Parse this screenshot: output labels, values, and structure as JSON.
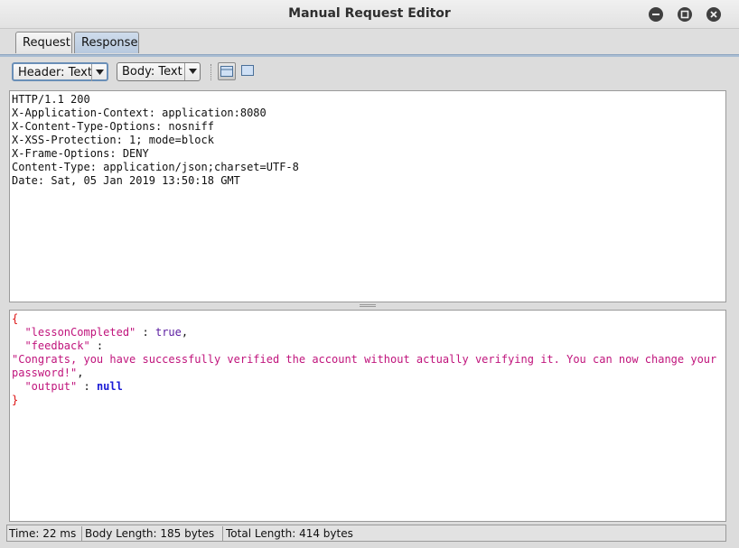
{
  "window": {
    "title": "Manual Request Editor"
  },
  "tabs": [
    {
      "label": "Request"
    },
    {
      "label": "Response"
    }
  ],
  "toolbar": {
    "header_select": "Header: Text",
    "body_select": "Body: Text"
  },
  "response_header": {
    "lines": [
      "HTTP/1.1 200",
      "X-Application-Context: application:8080",
      "X-Content-Type-Options: nosniff",
      "X-XSS-Protection: 1; mode=block",
      "X-Frame-Options: DENY",
      "Content-Type: application/json;charset=UTF-8",
      "Date: Sat, 05 Jan 2019 13:50:18 GMT"
    ]
  },
  "response_body": {
    "open_brace": "{",
    "close_brace": "}",
    "key1": "\"lessonCompleted\"",
    "val1": "true",
    "key2": "\"feedback\"",
    "val2": "\"Congrats, you have successfully verified the account without actually verifying it. You can now change your password!\"",
    "key3": "\"output\"",
    "val3": "null"
  },
  "status": {
    "time": "Time: 22 ms",
    "body_length": "Body Length: 185 bytes",
    "total_length": "Total Length: 414 bytes"
  },
  "colors": {
    "brace": "#dd1111",
    "json_key": "#c0147c",
    "json_bool": "#5a1ba0",
    "json_null": "#1b1bd6",
    "tab_active": "#b8c9de"
  },
  "icons": {
    "minimize": "minimize-icon",
    "maximize": "maximize-icon",
    "close": "close-icon",
    "split_view": "split-view-icon",
    "single_view": "single-view-icon"
  }
}
